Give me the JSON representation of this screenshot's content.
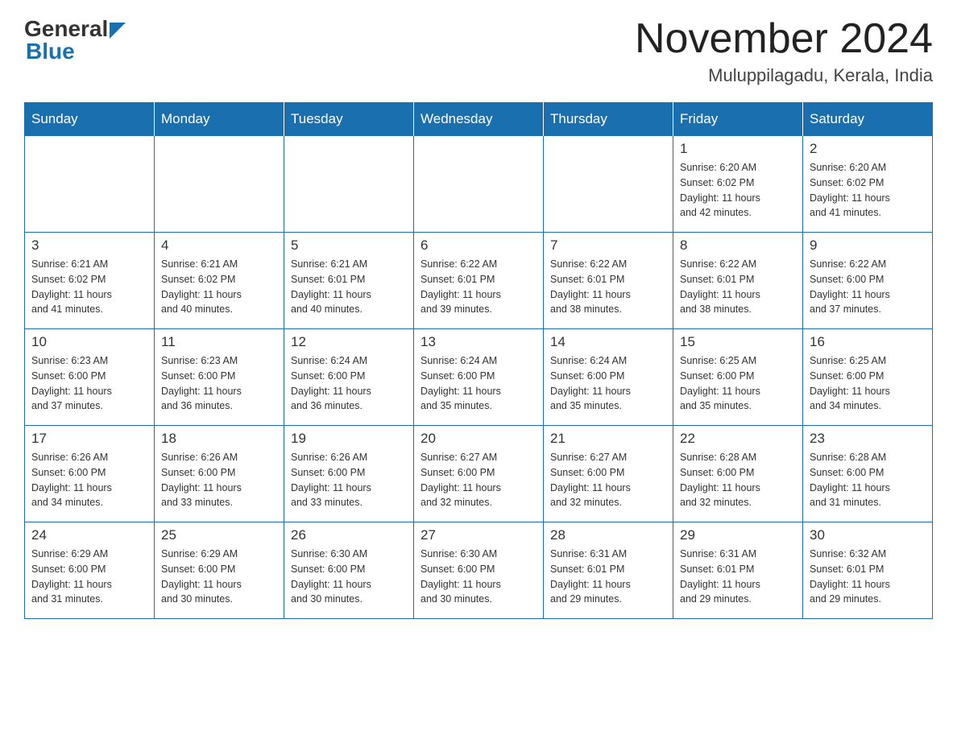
{
  "header": {
    "logo_general": "General",
    "logo_blue": "Blue",
    "month_title": "November 2024",
    "location": "Muluppilagadu, Kerala, India"
  },
  "days_of_week": [
    "Sunday",
    "Monday",
    "Tuesday",
    "Wednesday",
    "Thursday",
    "Friday",
    "Saturday"
  ],
  "weeks": [
    [
      {
        "day": "",
        "info": ""
      },
      {
        "day": "",
        "info": ""
      },
      {
        "day": "",
        "info": ""
      },
      {
        "day": "",
        "info": ""
      },
      {
        "day": "",
        "info": ""
      },
      {
        "day": "1",
        "info": "Sunrise: 6:20 AM\nSunset: 6:02 PM\nDaylight: 11 hours\nand 42 minutes."
      },
      {
        "day": "2",
        "info": "Sunrise: 6:20 AM\nSunset: 6:02 PM\nDaylight: 11 hours\nand 41 minutes."
      }
    ],
    [
      {
        "day": "3",
        "info": "Sunrise: 6:21 AM\nSunset: 6:02 PM\nDaylight: 11 hours\nand 41 minutes."
      },
      {
        "day": "4",
        "info": "Sunrise: 6:21 AM\nSunset: 6:02 PM\nDaylight: 11 hours\nand 40 minutes."
      },
      {
        "day": "5",
        "info": "Sunrise: 6:21 AM\nSunset: 6:01 PM\nDaylight: 11 hours\nand 40 minutes."
      },
      {
        "day": "6",
        "info": "Sunrise: 6:22 AM\nSunset: 6:01 PM\nDaylight: 11 hours\nand 39 minutes."
      },
      {
        "day": "7",
        "info": "Sunrise: 6:22 AM\nSunset: 6:01 PM\nDaylight: 11 hours\nand 38 minutes."
      },
      {
        "day": "8",
        "info": "Sunrise: 6:22 AM\nSunset: 6:01 PM\nDaylight: 11 hours\nand 38 minutes."
      },
      {
        "day": "9",
        "info": "Sunrise: 6:22 AM\nSunset: 6:00 PM\nDaylight: 11 hours\nand 37 minutes."
      }
    ],
    [
      {
        "day": "10",
        "info": "Sunrise: 6:23 AM\nSunset: 6:00 PM\nDaylight: 11 hours\nand 37 minutes."
      },
      {
        "day": "11",
        "info": "Sunrise: 6:23 AM\nSunset: 6:00 PM\nDaylight: 11 hours\nand 36 minutes."
      },
      {
        "day": "12",
        "info": "Sunrise: 6:24 AM\nSunset: 6:00 PM\nDaylight: 11 hours\nand 36 minutes."
      },
      {
        "day": "13",
        "info": "Sunrise: 6:24 AM\nSunset: 6:00 PM\nDaylight: 11 hours\nand 35 minutes."
      },
      {
        "day": "14",
        "info": "Sunrise: 6:24 AM\nSunset: 6:00 PM\nDaylight: 11 hours\nand 35 minutes."
      },
      {
        "day": "15",
        "info": "Sunrise: 6:25 AM\nSunset: 6:00 PM\nDaylight: 11 hours\nand 35 minutes."
      },
      {
        "day": "16",
        "info": "Sunrise: 6:25 AM\nSunset: 6:00 PM\nDaylight: 11 hours\nand 34 minutes."
      }
    ],
    [
      {
        "day": "17",
        "info": "Sunrise: 6:26 AM\nSunset: 6:00 PM\nDaylight: 11 hours\nand 34 minutes."
      },
      {
        "day": "18",
        "info": "Sunrise: 6:26 AM\nSunset: 6:00 PM\nDaylight: 11 hours\nand 33 minutes."
      },
      {
        "day": "19",
        "info": "Sunrise: 6:26 AM\nSunset: 6:00 PM\nDaylight: 11 hours\nand 33 minutes."
      },
      {
        "day": "20",
        "info": "Sunrise: 6:27 AM\nSunset: 6:00 PM\nDaylight: 11 hours\nand 32 minutes."
      },
      {
        "day": "21",
        "info": "Sunrise: 6:27 AM\nSunset: 6:00 PM\nDaylight: 11 hours\nand 32 minutes."
      },
      {
        "day": "22",
        "info": "Sunrise: 6:28 AM\nSunset: 6:00 PM\nDaylight: 11 hours\nand 32 minutes."
      },
      {
        "day": "23",
        "info": "Sunrise: 6:28 AM\nSunset: 6:00 PM\nDaylight: 11 hours\nand 31 minutes."
      }
    ],
    [
      {
        "day": "24",
        "info": "Sunrise: 6:29 AM\nSunset: 6:00 PM\nDaylight: 11 hours\nand 31 minutes."
      },
      {
        "day": "25",
        "info": "Sunrise: 6:29 AM\nSunset: 6:00 PM\nDaylight: 11 hours\nand 30 minutes."
      },
      {
        "day": "26",
        "info": "Sunrise: 6:30 AM\nSunset: 6:00 PM\nDaylight: 11 hours\nand 30 minutes."
      },
      {
        "day": "27",
        "info": "Sunrise: 6:30 AM\nSunset: 6:00 PM\nDaylight: 11 hours\nand 30 minutes."
      },
      {
        "day": "28",
        "info": "Sunrise: 6:31 AM\nSunset: 6:01 PM\nDaylight: 11 hours\nand 29 minutes."
      },
      {
        "day": "29",
        "info": "Sunrise: 6:31 AM\nSunset: 6:01 PM\nDaylight: 11 hours\nand 29 minutes."
      },
      {
        "day": "30",
        "info": "Sunrise: 6:32 AM\nSunset: 6:01 PM\nDaylight: 11 hours\nand 29 minutes."
      }
    ]
  ]
}
